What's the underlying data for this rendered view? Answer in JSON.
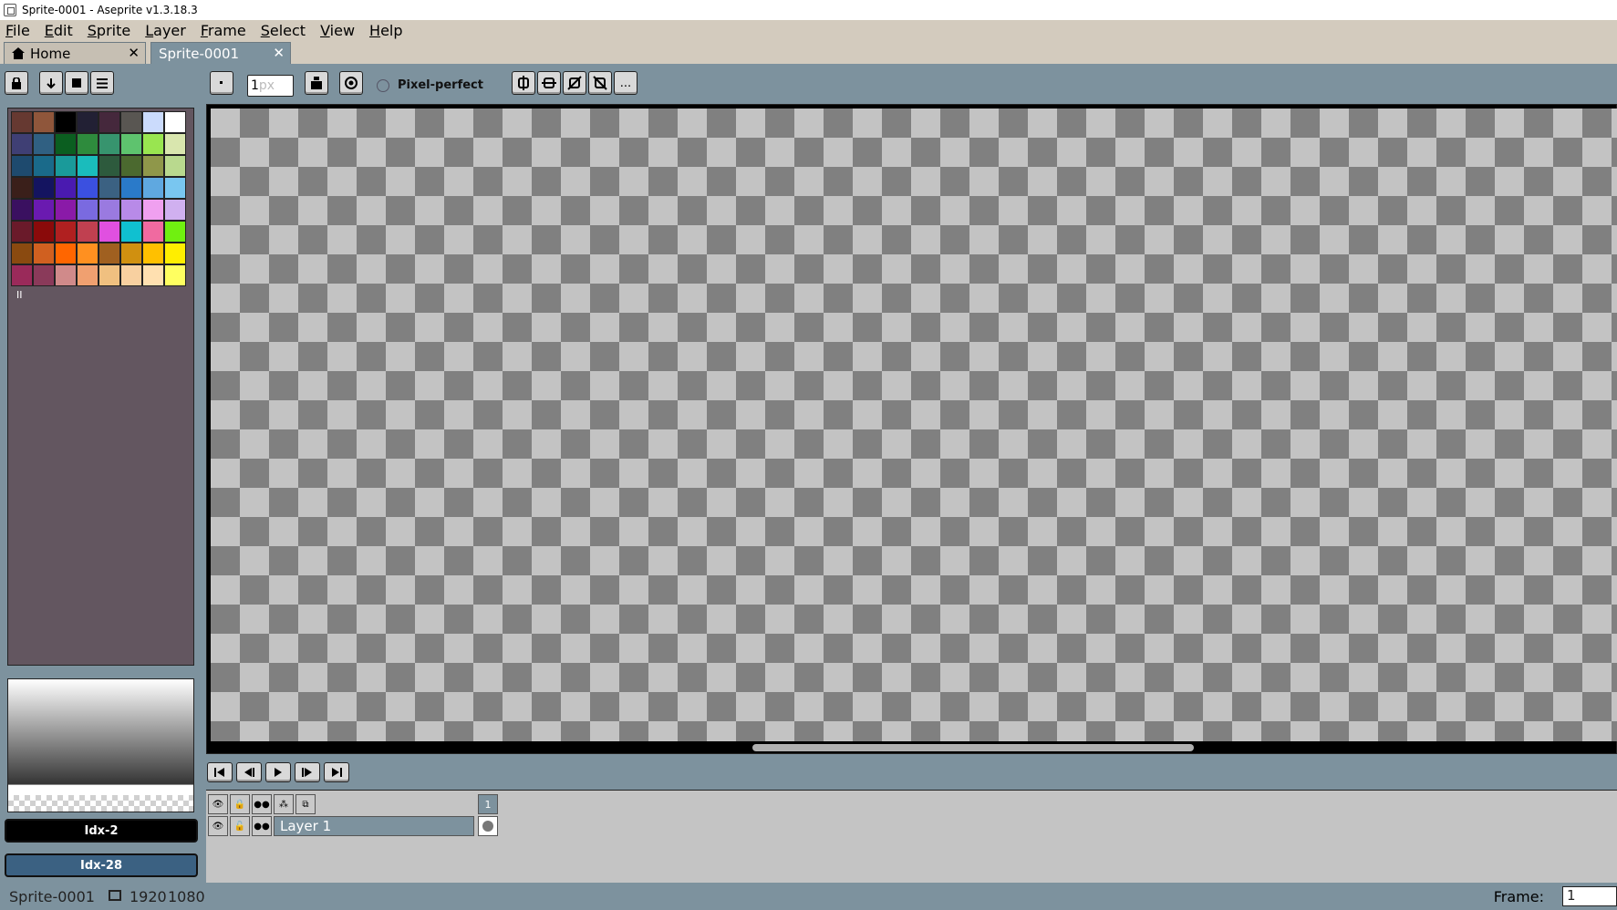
{
  "window": {
    "title": "Sprite-0001 - Aseprite v1.3.18.3"
  },
  "menu": [
    "File",
    "Edit",
    "Sprite",
    "Layer",
    "Frame",
    "Select",
    "View",
    "Help"
  ],
  "tabs": [
    {
      "label": "Home",
      "close": "✕"
    },
    {
      "label": "Sprite-0001",
      "close": "✕"
    }
  ],
  "toolbar": {
    "brush_size_placeholder": "1px",
    "brush_size_value": "1",
    "pixel_perfect_label": "Pixel-perfect",
    "more_label": "..."
  },
  "palette": {
    "colors": [
      "#663931",
      "#8f563b",
      "#000000",
      "#222034",
      "#45283c",
      "#595652",
      "#cbdbfc",
      "#ffffff",
      "#3f3f74",
      "#306082",
      "#0b5e20",
      "#2e8b3d",
      "#37946e",
      "#5ec36e",
      "#99e550",
      "#d9e6ae",
      "#1e4a6e",
      "#1a6a8a",
      "#1a9a9a",
      "#1abcbc",
      "#2d5a3d",
      "#4b692f",
      "#8f974a",
      "#b9d98e",
      "#3a1f1a",
      "#141460",
      "#4a1ab0",
      "#3b50e0",
      "#3b6182",
      "#2a7ac9",
      "#5fa8e0",
      "#79c6f0",
      "#3a1060",
      "#6a1ab0",
      "#8a1aa8",
      "#7a6ae0",
      "#9a7ae0",
      "#b88ae8",
      "#f0a0f0",
      "#d0b0f0",
      "#6a1a2a",
      "#8a0a0a",
      "#b02020",
      "#c04050",
      "#e050e0",
      "#10c0d0",
      "#f06aa0",
      "#70f010",
      "#8a4a10",
      "#d06020",
      "#ff6600",
      "#ff9020",
      "#a06020",
      "#d09010",
      "#ffc000",
      "#ffee00",
      "#9a2a5a",
      "#8a3a5a",
      "#d08a8a",
      "#f0a070",
      "#f0c080",
      "#f8d0a0",
      "#ffe0b0",
      "#ffff60"
    ],
    "count_label": "II"
  },
  "colorbars": {
    "fg": "Idx-2",
    "bg": "Idx-28"
  },
  "timeline": {
    "frame_number": "1",
    "layer_name": "Layer 1"
  },
  "status": {
    "sprite_name": "Sprite-0001",
    "width": "1920",
    "height": "1080",
    "frame_label": "Frame:",
    "frame_value": "1"
  },
  "colors": {
    "panel_bg": "#7d929e",
    "palette_bg": "#635660",
    "menu_bg": "#d3cbbe",
    "bg_color_bar": "#3b6182"
  }
}
